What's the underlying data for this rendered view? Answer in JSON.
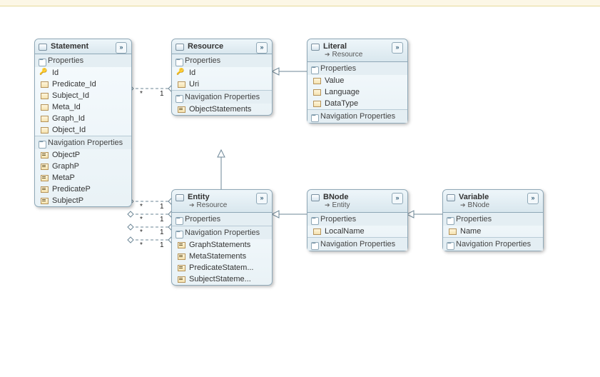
{
  "labels": {
    "properties": "Properties",
    "nav": "Navigation Properties"
  },
  "entities": {
    "statement": {
      "name": "Statement",
      "properties": [
        "Id",
        "Predicate_Id",
        "Subject_Id",
        "Meta_Id",
        "Graph_Id",
        "Object_Id"
      ],
      "nav": [
        "ObjectP",
        "GraphP",
        "MetaP",
        "PredicateP",
        "SubjectP"
      ]
    },
    "resource": {
      "name": "Resource",
      "properties": [
        "Id",
        "Uri"
      ],
      "nav": [
        "ObjectStatements"
      ]
    },
    "literal": {
      "name": "Literal",
      "base": "Resource",
      "properties": [
        "Value",
        "Language",
        "DataType"
      ],
      "nav": []
    },
    "entity": {
      "name": "Entity",
      "base": "Resource",
      "properties": [],
      "nav": [
        "GraphStatements",
        "MetaStatements",
        "PredicateStatem...",
        "SubjectStateme..."
      ]
    },
    "bnode": {
      "name": "BNode",
      "base": "Entity",
      "properties": [
        "LocalName"
      ],
      "nav": []
    },
    "variable": {
      "name": "Variable",
      "base": "BNode",
      "properties": [
        "Name"
      ],
      "nav": []
    }
  },
  "connectors": {
    "obj_many": "*",
    "obj_one": "1",
    "e1_many": "*",
    "e1_one": "1",
    "e2_many": "*",
    "e2_one": "1",
    "e3_many": "*",
    "e3_one": "1",
    "e4_many": "*",
    "e4_one": "1"
  }
}
